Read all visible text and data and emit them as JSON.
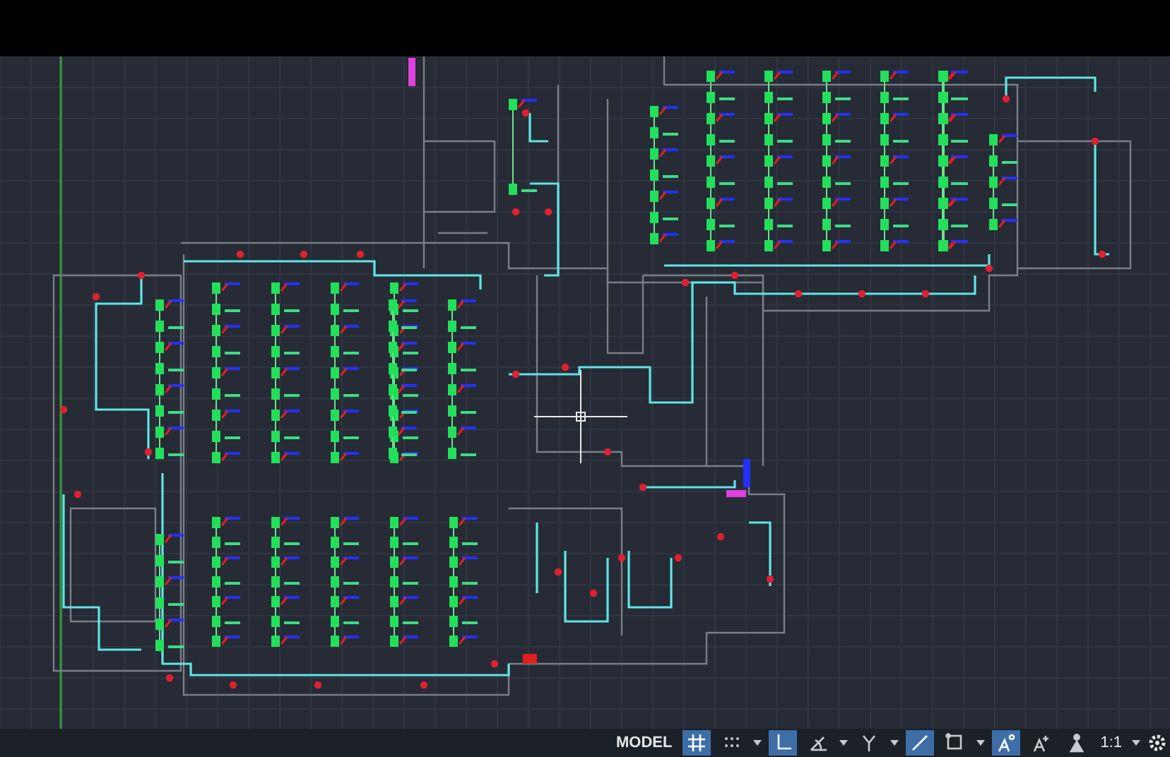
{
  "status_bar": {
    "space": "MODEL",
    "toggles": [
      {
        "kind": "grid",
        "on": true,
        "menu": false
      },
      {
        "kind": "snap",
        "on": false,
        "menu": true
      },
      {
        "kind": "ortho",
        "on": true,
        "menu": false
      },
      {
        "kind": "polar",
        "on": false,
        "menu": true
      },
      {
        "kind": "isodraft",
        "on": false,
        "menu": true
      },
      {
        "kind": "tracking",
        "on": true,
        "menu": false
      },
      {
        "kind": "osnap",
        "on": false,
        "menu": true
      },
      {
        "kind": "annotation",
        "on": true,
        "menu": false
      },
      {
        "kind": "autoscale",
        "on": false,
        "menu": false
      },
      {
        "kind": "person",
        "on": false,
        "menu": false
      }
    ],
    "scale": "1:1"
  }
}
